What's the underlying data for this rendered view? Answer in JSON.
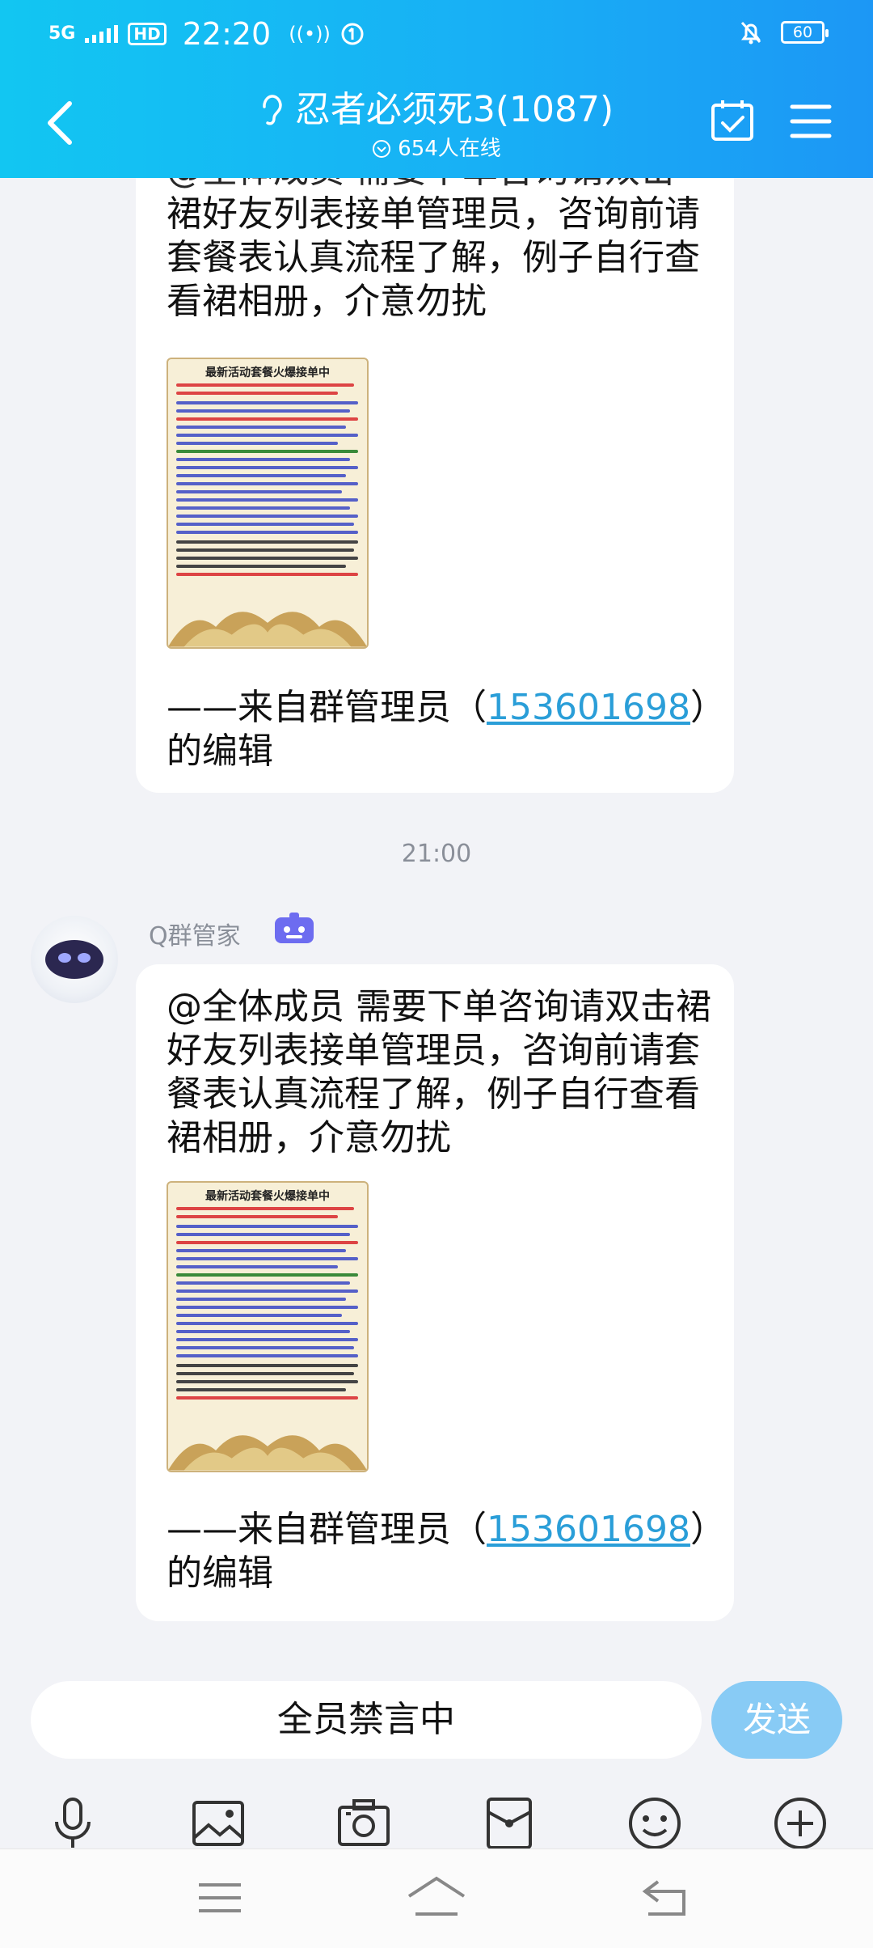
{
  "status_bar": {
    "network": "5G",
    "hd": "HD",
    "time": "22:20",
    "extra": "((•))",
    "battery": "60"
  },
  "header": {
    "title": "忍者必须死3(1087)",
    "subtitle": "654人在线"
  },
  "messages": [
    {
      "text_top_cut": "@全体成员 需要下单咨询请双击",
      "text": "裙好友列表接单管理员，咨询前请套餐表认真流程了解，例子自行查看裙相册，介意勿扰",
      "poster_title": "最新活动套餐火爆接单中",
      "sign_prefix": "——来自群管理员（",
      "sign_link": "153601698",
      "sign_suffix": "）的编辑"
    }
  ],
  "time_separator": "21:00",
  "sender": {
    "name": "Q群管家"
  },
  "message2": {
    "text": "@全体成员 需要下单咨询请双击裙好友列表接单管理员，咨询前请套餐表认真流程了解，例子自行查看裙相册，介意勿扰",
    "poster_title": "最新活动套餐火爆接单中",
    "sign_prefix": "——来自群管理员（",
    "sign_link": "153601698",
    "sign_suffix": "）的编辑"
  },
  "input": {
    "placeholder": "全员禁言中",
    "send_label": "发送"
  },
  "toolbar": {
    "icons": [
      "mic-icon",
      "image-icon",
      "camera-icon",
      "red-packet-icon",
      "emoji-icon",
      "plus-icon"
    ]
  },
  "colors": {
    "header_start": "#12c6f2",
    "header_end": "#1c97f5",
    "link": "#2a9ed8",
    "send_button": "#88cbf5"
  }
}
